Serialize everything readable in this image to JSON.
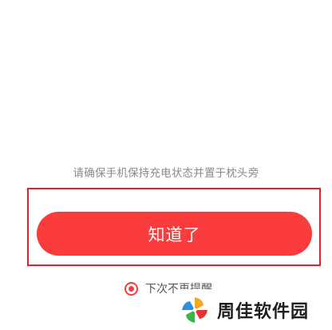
{
  "dialog": {
    "hint_text": "请确保手机保持充电状态并置于枕头旁",
    "confirm_button_label": "知道了",
    "dont_remind_label": "下次不再提醒",
    "dont_remind_checked": true
  },
  "watermark": {
    "text": "周佳软件园",
    "logo_icon": "pinwheel-logo-icon"
  },
  "colors": {
    "accent": "#fa3c3c",
    "highlight_border": "#ee1c24",
    "hint_text": "#8a8a8a"
  }
}
